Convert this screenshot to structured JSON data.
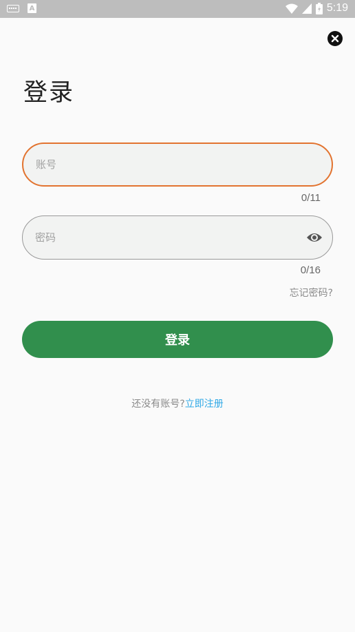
{
  "status_bar": {
    "time": "5:19",
    "a_label": "A"
  },
  "page": {
    "title": "登录"
  },
  "account": {
    "placeholder": "账号",
    "value": "",
    "counter": "0/11"
  },
  "password": {
    "placeholder": "密码",
    "value": "",
    "counter": "0/16"
  },
  "forgot_label": "忘记密码?",
  "login_label": "登录",
  "register": {
    "prompt": "还没有账号?",
    "link": "立即注册"
  },
  "colors": {
    "primary_button": "#318f4d",
    "focus_border": "#e2732f",
    "link": "#2ea8e6"
  },
  "icons": [
    "keyboard-icon",
    "a-notification-icon",
    "wifi-icon",
    "signal-icon",
    "battery-icon",
    "close-icon",
    "eye-icon"
  ]
}
